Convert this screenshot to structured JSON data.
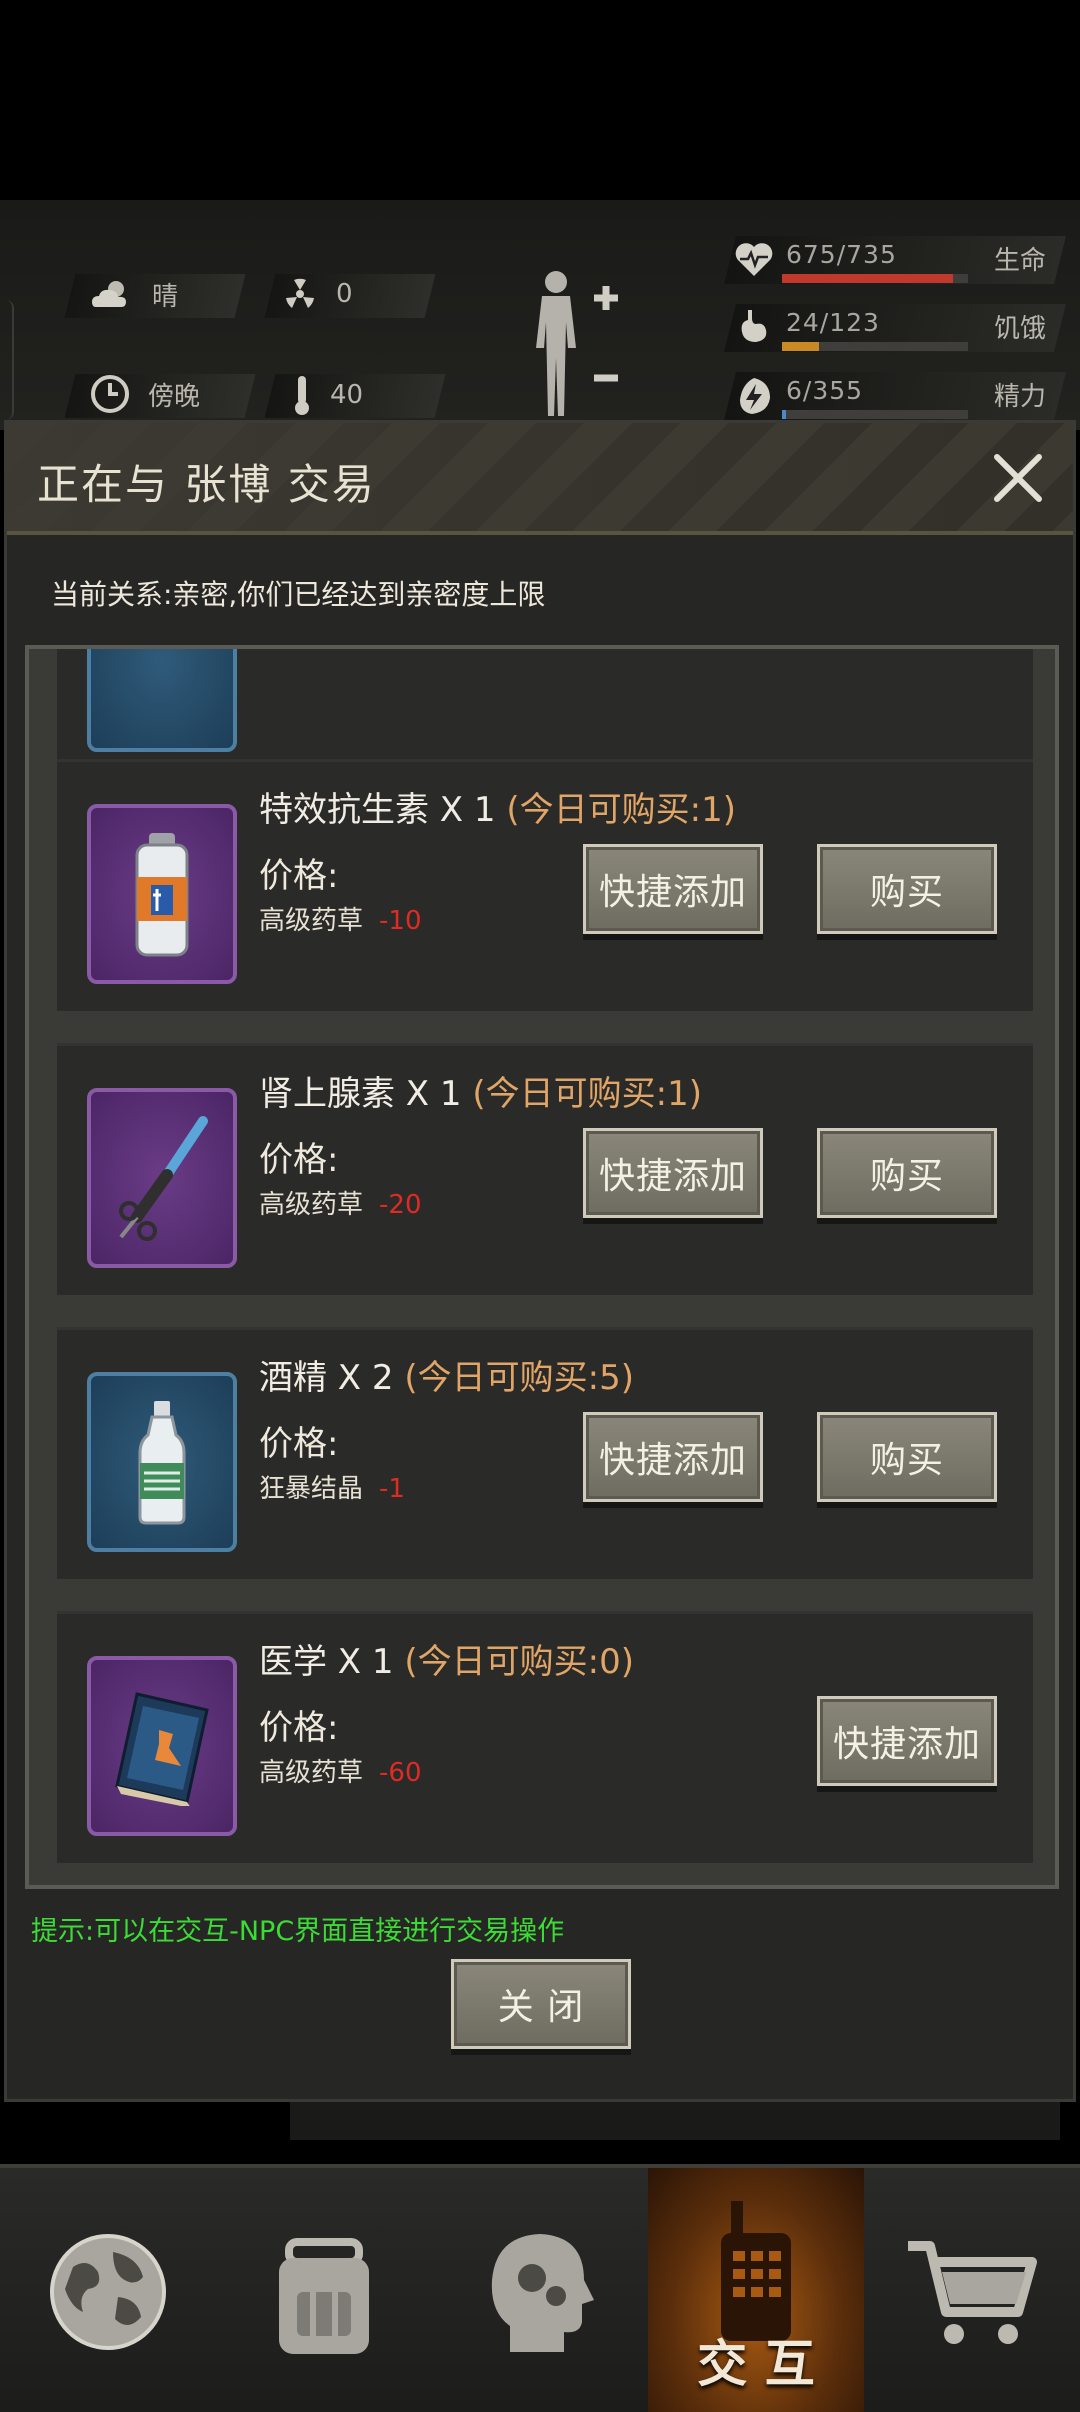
{
  "hud": {
    "weather": "晴",
    "radiation": "0",
    "time_of_day": "傍晚",
    "temperature": "40",
    "stats": [
      {
        "value": "675/735",
        "label": "生命",
        "fraction": 0.92,
        "color": "#c0392b",
        "icon": "heart-pulse-icon"
      },
      {
        "value": "24/123",
        "label": "饥饿",
        "fraction": 0.2,
        "color": "#c98a25",
        "icon": "stomach-icon"
      },
      {
        "value": "6/355",
        "label": "精力",
        "fraction": 0.02,
        "color": "#4a8ac9",
        "icon": "energy-icon"
      }
    ]
  },
  "dialog": {
    "title": "正在与 张博 交易",
    "relation": "当前关系:亲密,你们已经达到亲密度上限",
    "items": [
      {
        "name": "特效抗生素 X 1",
        "limit": "(今日可购买:1)",
        "price_label": "价格:",
        "currency": "高级药草",
        "amount": "-10",
        "icon": "antibiotic-spray-icon",
        "frame": "purple",
        "quick_add": "快捷添加",
        "buy": "购买"
      },
      {
        "name": "肾上腺素 X 1",
        "limit": "(今日可购买:1)",
        "price_label": "价格:",
        "currency": "高级药草",
        "amount": "-20",
        "icon": "syringe-icon",
        "frame": "purple",
        "quick_add": "快捷添加",
        "buy": "购买"
      },
      {
        "name": "酒精 X 2",
        "limit": "(今日可购买:5)",
        "price_label": "价格:",
        "currency": "狂暴结晶",
        "amount": "-1",
        "icon": "alcohol-bottle-icon",
        "frame": "blue",
        "quick_add": "快捷添加",
        "buy": "购买"
      },
      {
        "name": "医学 X 1",
        "limit": "(今日可购买:0)",
        "price_label": "价格:",
        "currency": "高级药草",
        "amount": "-60",
        "icon": "medical-book-icon",
        "frame": "purple",
        "quick_add": "快捷添加"
      }
    ],
    "hint": "提示:可以在交互-NPC界面直接进行交易操作",
    "close_label": "关 闭"
  },
  "nav": {
    "items": [
      {
        "icon": "globe-icon"
      },
      {
        "icon": "backpack-icon"
      },
      {
        "icon": "head-gears-icon"
      },
      {
        "icon": "walkie-talkie-icon",
        "label": "交 互",
        "active": true
      },
      {
        "icon": "shopping-cart-icon"
      }
    ]
  }
}
